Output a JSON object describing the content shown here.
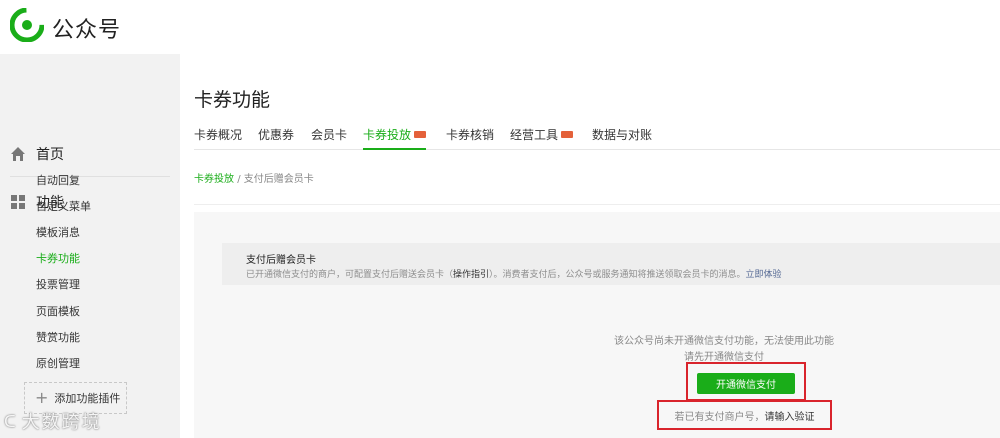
{
  "header": {
    "brand": "公众号",
    "logo_icon": "wechat-official-account-logo-icon",
    "brand_color": "#1aad19"
  },
  "sidebar": {
    "home_label": "首页",
    "home_icon": "home-icon",
    "function_label": "功能",
    "function_icon": "grid-icon",
    "items": [
      {
        "label": "自动回复",
        "active": false
      },
      {
        "label": "自定义菜单",
        "active": false
      },
      {
        "label": "模板消息",
        "active": false
      },
      {
        "label": "卡券功能",
        "active": true
      },
      {
        "label": "投票管理",
        "active": false
      },
      {
        "label": "页面模板",
        "active": false
      },
      {
        "label": "赞赏功能",
        "active": false
      },
      {
        "label": "原创管理",
        "active": false
      }
    ],
    "add_plugin_label": "添加功能插件"
  },
  "main": {
    "title": "卡券功能",
    "tabs": [
      {
        "label": "卡券概况",
        "active": false,
        "new": false
      },
      {
        "label": "优惠券",
        "active": false,
        "new": false
      },
      {
        "label": "会员卡",
        "active": false,
        "new": false
      },
      {
        "label": "卡券投放",
        "active": true,
        "new": true
      },
      {
        "label": "卡券核销",
        "active": false,
        "new": false
      },
      {
        "label": "经营工具",
        "active": false,
        "new": true
      },
      {
        "label": "数据与对账",
        "active": false,
        "new": false
      }
    ],
    "breadcrumb": {
      "parent": "卡券投放",
      "separator": "/",
      "current": "支付后赠会员卡"
    }
  },
  "info": {
    "title": "支付后赠会员卡",
    "desc_prefix": "已开通微信支付的商户，可配置支付后赠送会员卡（",
    "guide_link": "操作指引",
    "desc_suffix": "）。消费者支付后，公众号或服务通知将推送领取会员卡的消息。",
    "try_link": "立即体验"
  },
  "notice": {
    "line1": "该公众号尚未开通微信支付功能，无法使用此功能",
    "line2": "请先开通微信支付",
    "open_button": "开通微信支付",
    "verify_prefix": "若已有支付商户号，",
    "verify_link": "请输入验证"
  },
  "watermark": "大数跨境"
}
